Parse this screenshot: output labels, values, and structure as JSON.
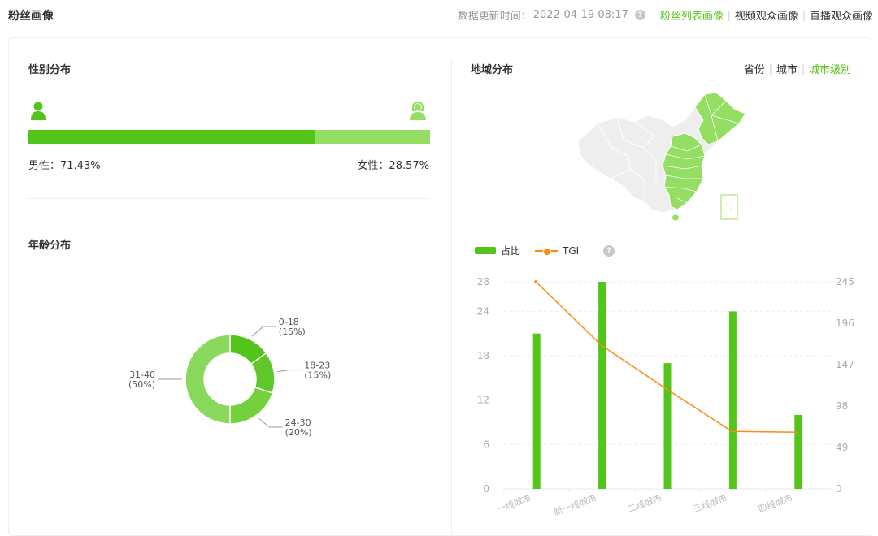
{
  "header": {
    "title": "粉丝画像",
    "update_label": "数据更新时间：",
    "update_time": "2022-04-19 08:17",
    "views": [
      {
        "label": "粉丝列表画像",
        "active": true
      },
      {
        "label": "视频观众画像",
        "active": false
      },
      {
        "label": "直播观众画像",
        "active": false
      }
    ]
  },
  "gender": {
    "title": "性别分布",
    "male_label": "男性：71.43%",
    "female_label": "女性：28.57%",
    "male_fraction": 0.7143,
    "colors": {
      "male": "#52c41a",
      "female": "#95de64"
    }
  },
  "age": {
    "title": "年龄分布",
    "chart_data": {
      "type": "pie",
      "variant": "donut",
      "slices": [
        {
          "label": "0-18",
          "pct_label": "(15%)",
          "value": 15,
          "color": "#52c41a"
        },
        {
          "label": "18-23",
          "pct_label": "(15%)",
          "value": 15,
          "color": "#61c82b"
        },
        {
          "label": "24-30",
          "pct_label": "(20%)",
          "value": 20,
          "color": "#73d13d"
        },
        {
          "label": "31-40",
          "pct_label": "(50%)",
          "value": 50,
          "color": "#89d95c"
        }
      ]
    }
  },
  "region": {
    "title": "地域分布",
    "tabs": [
      {
        "label": "省份",
        "active": false
      },
      {
        "label": "城市",
        "active": false
      },
      {
        "label": "城市级别",
        "active": true
      }
    ]
  },
  "chart_data": {
    "type": "bar",
    "categories": [
      "一线城市",
      "新一线城市",
      "二线城市",
      "三线城市",
      "四线城市"
    ],
    "series": [
      {
        "name": "占比",
        "type": "bar",
        "axis": "left",
        "values": [
          21,
          28,
          17,
          24,
          10
        ],
        "color": "#52c41a"
      },
      {
        "name": "TGI",
        "type": "line",
        "axis": "right",
        "values": [
          245,
          170,
          118,
          68,
          67
        ],
        "color": "#fa8c16"
      }
    ],
    "y_left": {
      "ticks": [
        0,
        6,
        12,
        18,
        24,
        28
      ],
      "min": 0,
      "max": 28
    },
    "y_right": {
      "ticks": [
        0,
        49,
        98,
        147,
        196,
        245
      ],
      "min": 0,
      "max": 245
    },
    "grid": true,
    "legend": "top-left"
  }
}
